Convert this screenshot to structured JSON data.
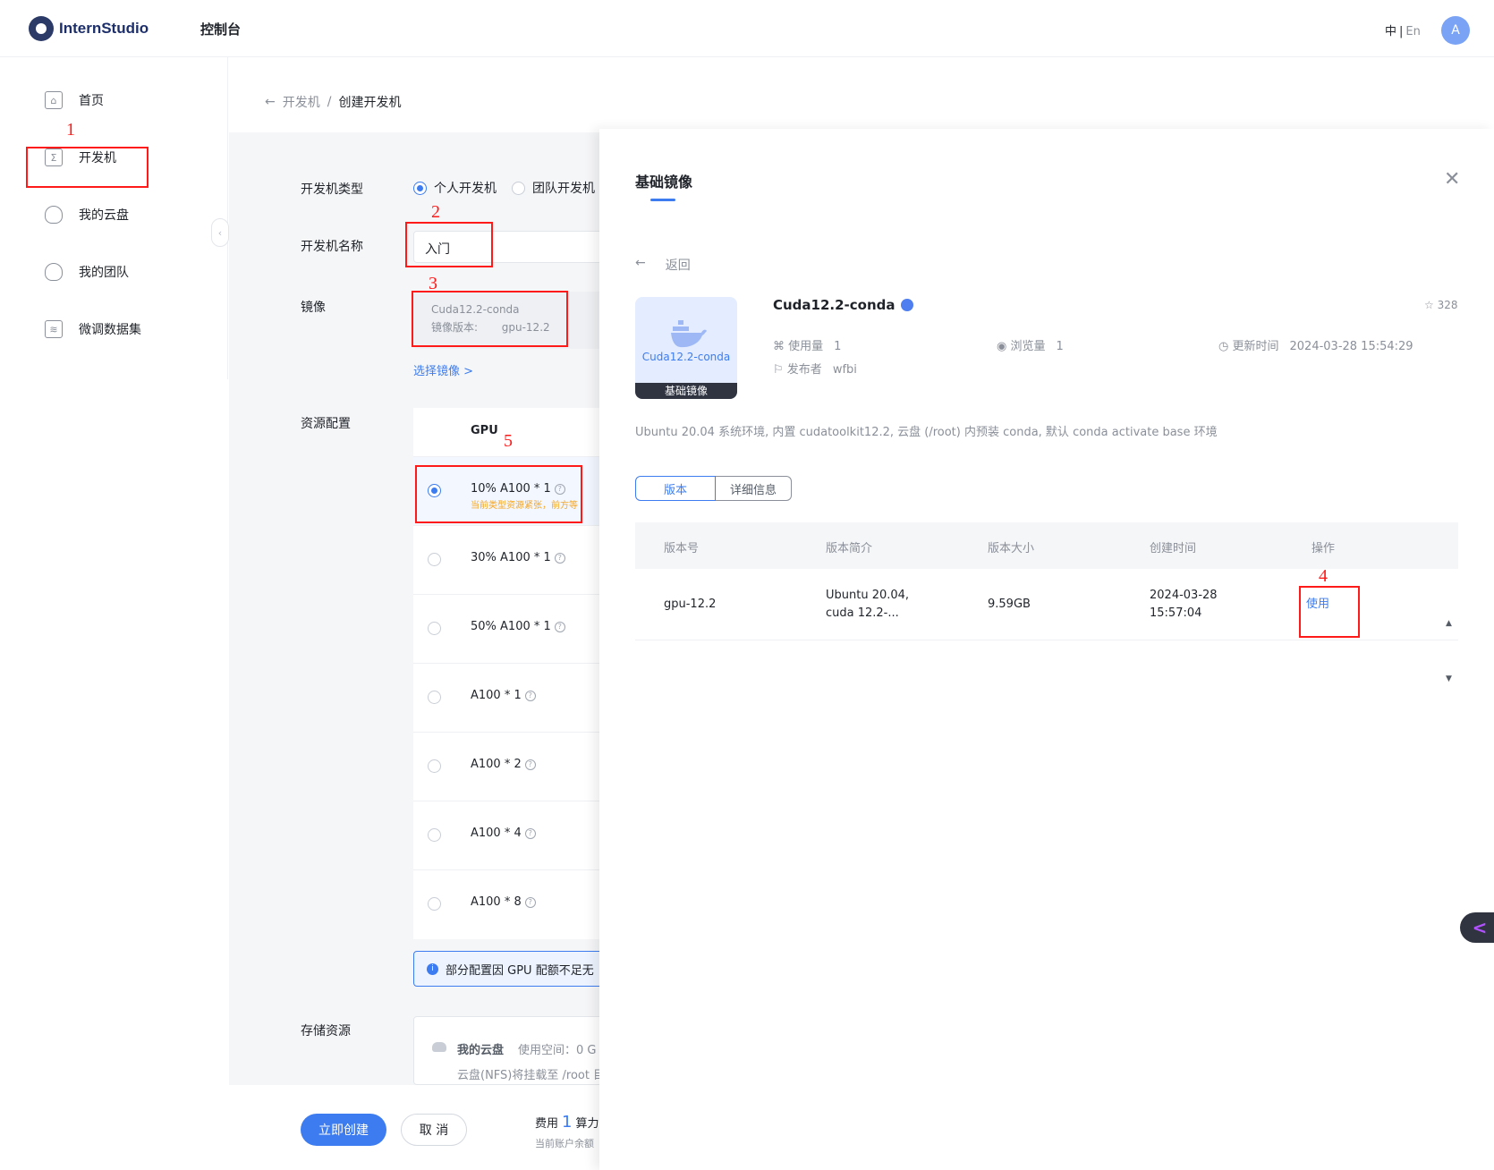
{
  "header": {
    "logo_text": "InternStudio",
    "nav_console": "控制台",
    "lang_zh": "中",
    "lang_sep": "|",
    "lang_en": "En",
    "avatar_letter": "A"
  },
  "sidebar": {
    "items": [
      {
        "label": "首页",
        "icon": "home-icon"
      },
      {
        "label": "开发机",
        "icon": "terminal-icon"
      },
      {
        "label": "我的云盘",
        "icon": "cloud-icon"
      },
      {
        "label": "我的团队",
        "icon": "team-icon"
      },
      {
        "label": "微调数据集",
        "icon": "layers-icon"
      }
    ],
    "collapse_glyph": "‹"
  },
  "annotations": {
    "n1": "1",
    "n2": "2",
    "n3": "3",
    "n4": "4",
    "n5": "5",
    "color": "#ff1a1a"
  },
  "breadcrumb": {
    "back_glyph": "←",
    "parent": "开发机",
    "sep": "/",
    "current": "创建开发机"
  },
  "form": {
    "type_label": "开发机类型",
    "type_options": [
      "个人开发机",
      "团队开发机"
    ],
    "type_selected": "个人开发机",
    "name_label": "开发机名称",
    "name_value": "入门",
    "image_label": "镜像",
    "image_name": "Cuda12.2-conda",
    "image_version_label": "镜像版本:",
    "image_version_value": "gpu-12.2",
    "select_image_link": "选择镜像 >",
    "resource_label": "资源配置",
    "gpu_header": "GPU",
    "gpu_options": [
      {
        "label": "10% A100 * 1",
        "warn": "当前类型资源紧张，前方等",
        "selected": true
      },
      {
        "label": "30% A100 * 1",
        "warn": "",
        "selected": false
      },
      {
        "label": "50% A100 * 1",
        "warn": "",
        "selected": false
      },
      {
        "label": "A100 * 1",
        "warn": "",
        "selected": false
      },
      {
        "label": "A100 * 2",
        "warn": "",
        "selected": false
      },
      {
        "label": "A100 * 4",
        "warn": "",
        "selected": false
      },
      {
        "label": "A100 * 8",
        "warn": "",
        "selected": false
      }
    ],
    "info_text": "部分配置因 GPU 配额不足无",
    "storage_label": "存储资源",
    "storage_title": "我的云盘",
    "storage_usage": "使用空间：0 G",
    "storage_mount": "云盘(NFS)将挂载至 /root 目"
  },
  "footer": {
    "create_button": "立即创建",
    "cancel_button": "取 消",
    "fee_label": "费用",
    "fee_value": "1",
    "fee_unit": "算力",
    "balance_text": "当前账户余额"
  },
  "drawer": {
    "title": "基础镜像",
    "close_glyph": "✕",
    "back_glyph": "←",
    "back_label": "返回",
    "thumb_caption": "Cuda12.2-conda",
    "thumb_footer": "基础镜像",
    "image_name": "Cuda12.2-conda",
    "stars": "328",
    "usage_label": "使用量",
    "usage_value": "1",
    "views_label": "浏览量",
    "views_value": "1",
    "updated_label": "更新时间",
    "updated_value": "2024-03-28 15:54:29",
    "publisher_label": "发布者",
    "publisher_value": "wfbi",
    "description": "Ubuntu 20.04 系统环境, 内置 cudatoolkit12.2, 云盘 (/root) 内预装 conda, 默认 conda activate base 环境",
    "tabs": [
      "版本",
      "详细信息"
    ],
    "table": {
      "headers": [
        "版本号",
        "版本简介",
        "版本大小",
        "创建时间",
        "操作"
      ],
      "rows": [
        {
          "version": "gpu-12.2",
          "intro_line1": "Ubuntu 20.04,",
          "intro_line2": "cuda 12.2-...",
          "size": "9.59GB",
          "created_date": "2024-03-28",
          "created_time": "15:57:04",
          "action": "使用"
        }
      ]
    }
  },
  "colors": {
    "accent": "#3c7cf0",
    "warning": "#f5a623",
    "annotation": "#ff1a1a"
  }
}
